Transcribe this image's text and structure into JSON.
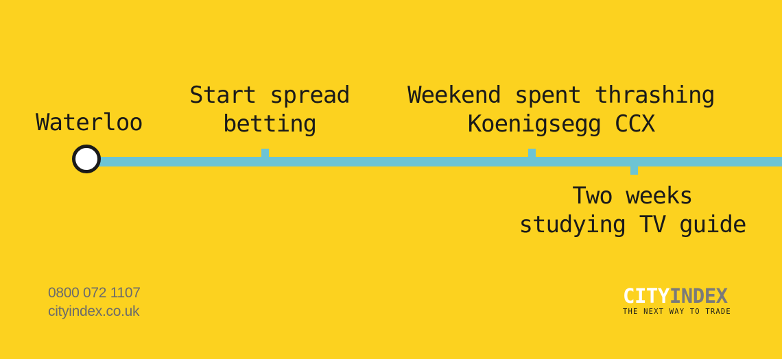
{
  "colors": {
    "background": "#FCD21F",
    "line": "#6DC4D4",
    "text": "#1A1A1A",
    "contact_text": "#6B6B6B",
    "logo_city": "#FFFFFF",
    "logo_index": "#7A7A7A"
  },
  "route": {
    "origin": "Waterloo",
    "stops": [
      {
        "line1": "Start spread",
        "line2": "betting"
      },
      {
        "line1": "Weekend spent thrashing",
        "line2": "Koenigsegg CCX"
      },
      {
        "line1": "Two weeks",
        "line2": "studying TV guide"
      }
    ]
  },
  "contact": {
    "phone": "0800 072 1107",
    "website": "cityindex.co.uk"
  },
  "logo": {
    "city": "CITY",
    "index": "INDEX",
    "tagline": "THE NEXT WAY TO TRADE"
  }
}
